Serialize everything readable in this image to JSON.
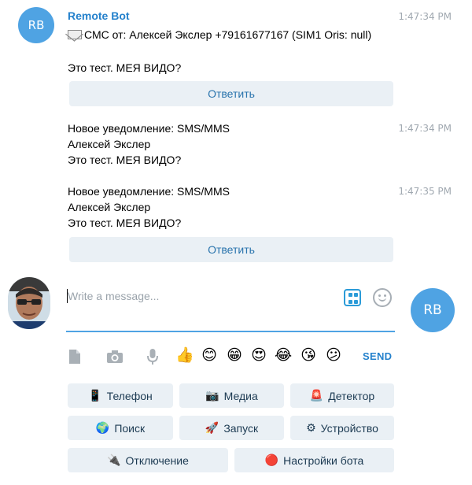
{
  "chat": {
    "bot_initials": "RB",
    "sender_name": "Remote Bot",
    "messages": [
      {
        "time": "1:47:34 PM",
        "lines": [
          "СМС от: Алексей Экслер +79161677167 (SIM1 Oris: null)",
          "",
          "Это тест. МЕЯ ВИДО?"
        ],
        "reply_label": "Ответить"
      },
      {
        "time": "1:47:34 PM",
        "lines": [
          "Новое уведомление: SMS/MMS",
          "Алексей Экслер",
          "Это тест. МЕЯ ВИДО?"
        ]
      },
      {
        "time": "1:47:35 PM",
        "lines": [
          "Новое уведомление: SMS/MMS",
          "Алексей Экслер",
          "Это тест. МЕЯ ВИДО?"
        ],
        "reply_label": "Ответить"
      }
    ]
  },
  "composer": {
    "placeholder": "Write a message...",
    "send_label": "SEND",
    "emojis": [
      "👍",
      "😊",
      "😁",
      "😍",
      "😂",
      "😘",
      "😕"
    ]
  },
  "keyboard": {
    "rows": [
      [
        {
          "icon": "📱",
          "label": "Телефон"
        },
        {
          "icon": "📷",
          "label": "Медиа"
        },
        {
          "icon": "🚨",
          "label": "Детектор"
        }
      ],
      [
        {
          "icon": "🌍",
          "label": "Поиск"
        },
        {
          "icon": "🚀",
          "label": "Запуск"
        },
        {
          "icon": "⚙",
          "label": "Устройство"
        }
      ],
      [
        {
          "icon": "🔌",
          "label": "Отключение"
        },
        {
          "icon": "🔴",
          "label": "Настройки бота"
        }
      ]
    ]
  },
  "colors": {
    "accent": "#4fa3e3",
    "link": "#2481cc",
    "button_bg": "#eaf0f5",
    "timestamp": "#a0a8b0"
  }
}
